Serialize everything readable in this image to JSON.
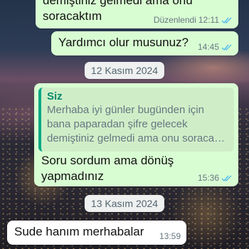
{
  "messages": [
    {
      "line1": "demiştiniz gelmedi ama onu",
      "line2": "soracaktım",
      "status": "Düzenlendi",
      "time": "12:11",
      "direction": "outgoing"
    },
    {
      "text": "Yardımcı olur musunuz?",
      "time": "14:45",
      "direction": "outgoing"
    },
    {
      "quote_author": "Siz",
      "quote_lines": [
        "Merhaba iyi günler bugünden için",
        "bana paparadan şifre gelecek",
        "demiştiniz gelmedi ama onu soraca…"
      ],
      "line1": "Soru sordum ama dönüş",
      "line2": "yapmadınız",
      "time": "15:36",
      "direction": "outgoing"
    },
    {
      "text": "Sude hanım merhabalar",
      "time": "13:59",
      "direction": "incoming"
    }
  ],
  "date_separators": [
    "12 Kasım 2024",
    "13 Kasım 2024"
  ],
  "colors": {
    "outgoing_bubble": "#d9fdd3",
    "incoming_bubble": "#ffffff",
    "read_ticks": "#53bdeb",
    "quote_accent": "#06a884"
  },
  "icons": {
    "read_receipt": "double-check-icon"
  }
}
